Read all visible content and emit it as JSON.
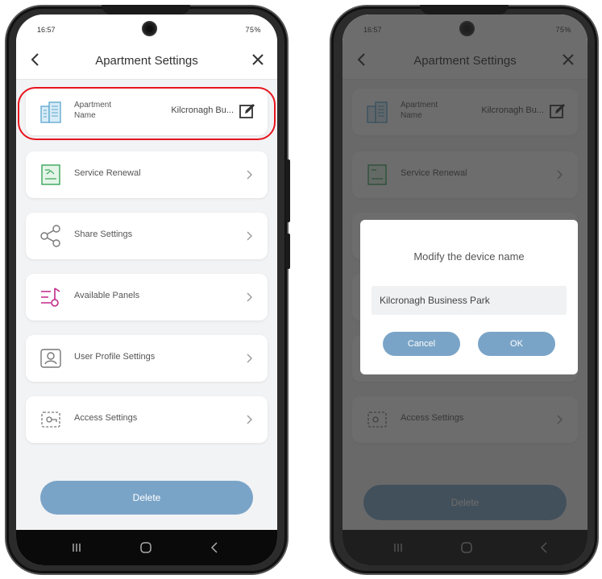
{
  "status_bar": {
    "time": "16:57",
    "right": "75%"
  },
  "header": {
    "title": "Apartment Settings"
  },
  "cards": [
    {
      "label": "Apartment Name",
      "value": "Kilcronagh Bu..."
    },
    {
      "label": "Service Renewal"
    },
    {
      "label": "Share Settings"
    },
    {
      "label": "Available Panels"
    },
    {
      "label": "User Profile Settings"
    },
    {
      "label": "Access Settings"
    }
  ],
  "delete_label": "Delete",
  "dialog": {
    "title": "Modify the device name",
    "input_value": "Kilcronagh Business Park",
    "cancel_label": "Cancel",
    "ok_label": "OK"
  },
  "colors": {
    "accent": "#7aa4c7",
    "highlight": "#e8141e",
    "overlay": "#3a3a3a"
  },
  "icons": [
    "chevron-left-icon",
    "close-icon",
    "building-icon",
    "edit-icon",
    "service-renewal-icon",
    "share-icon",
    "panels-icon",
    "user-profile-icon",
    "access-icon",
    "chevron-right-icon",
    "recent-apps-icon",
    "home-icon",
    "back-icon"
  ]
}
